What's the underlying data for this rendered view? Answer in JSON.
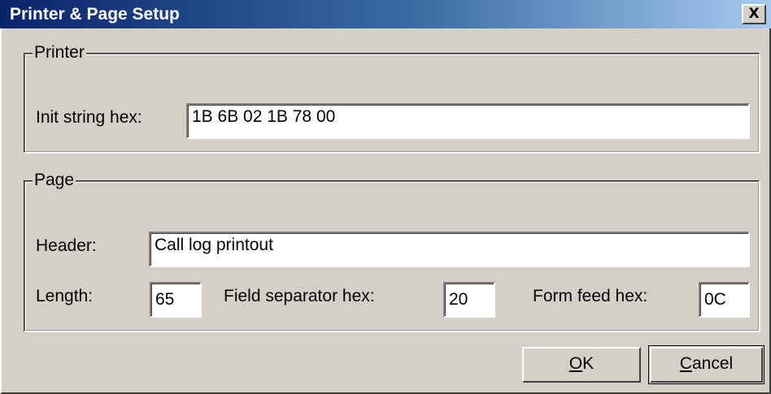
{
  "window": {
    "title": "Printer & Page Setup",
    "close_label": "X"
  },
  "printer": {
    "group_label": "Printer",
    "init_label": "Init string hex:",
    "init_value": "1B 6B 02 1B 78 00"
  },
  "page": {
    "group_label": "Page",
    "header_label": "Header:",
    "header_value": "Call log printout",
    "length_label": "Length:",
    "length_value": "65",
    "field_sep_label": "Field separator hex:",
    "field_sep_value": "20",
    "form_feed_label": "Form feed hex:",
    "form_feed_value": "0C"
  },
  "buttons": {
    "ok_mnemonic": "O",
    "ok_rest": "K",
    "cancel_mnemonic": "C",
    "cancel_rest": "ancel"
  }
}
